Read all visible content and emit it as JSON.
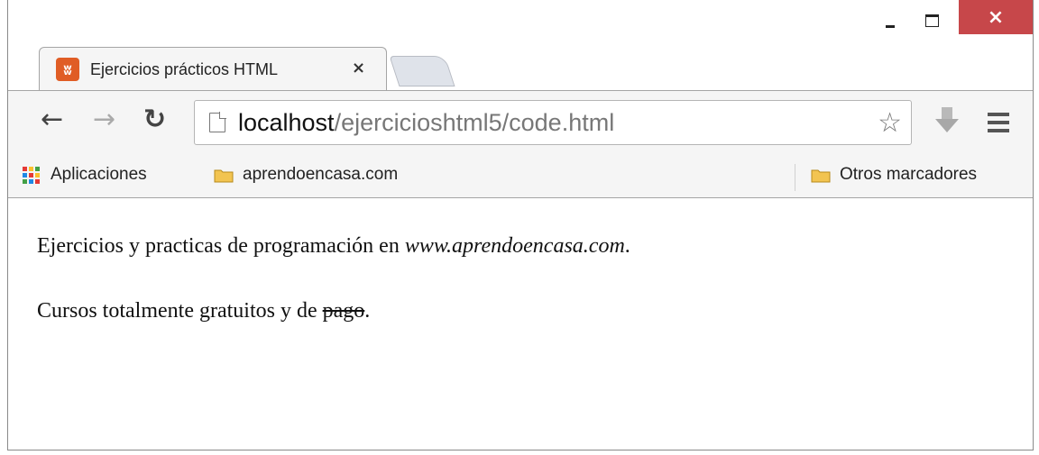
{
  "tab": {
    "title": "Ejercicios prácticos HTML",
    "close": "×",
    "icon": "xampp-icon"
  },
  "window": {
    "close": "×"
  },
  "toolbar": {
    "url_host": "localhost",
    "url_path": "/ejercicioshtml5/code.html",
    "back_icon": "arrow-left-icon",
    "forward_icon": "arrow-right-icon",
    "reload_icon": "reload-icon",
    "star_icon": "star-icon",
    "menu_icon": "hamburger-icon"
  },
  "bookmarks": {
    "apps": "Aplicaciones",
    "item1": "aprendoencasa.com",
    "other": "Otros marcadores"
  },
  "content": {
    "line1_text": "Ejercicios y practicas de programación en ",
    "line1_site": "www.aprendoencasa.com",
    "line1_end": ".",
    "line2_text": "Cursos totalmente gratuitos y de ",
    "line2_strike": "pago",
    "line2_end": "."
  },
  "colors": {
    "close_button": "#c7474a",
    "tab_icon": "#e05d25",
    "folder": "#f2c451"
  }
}
